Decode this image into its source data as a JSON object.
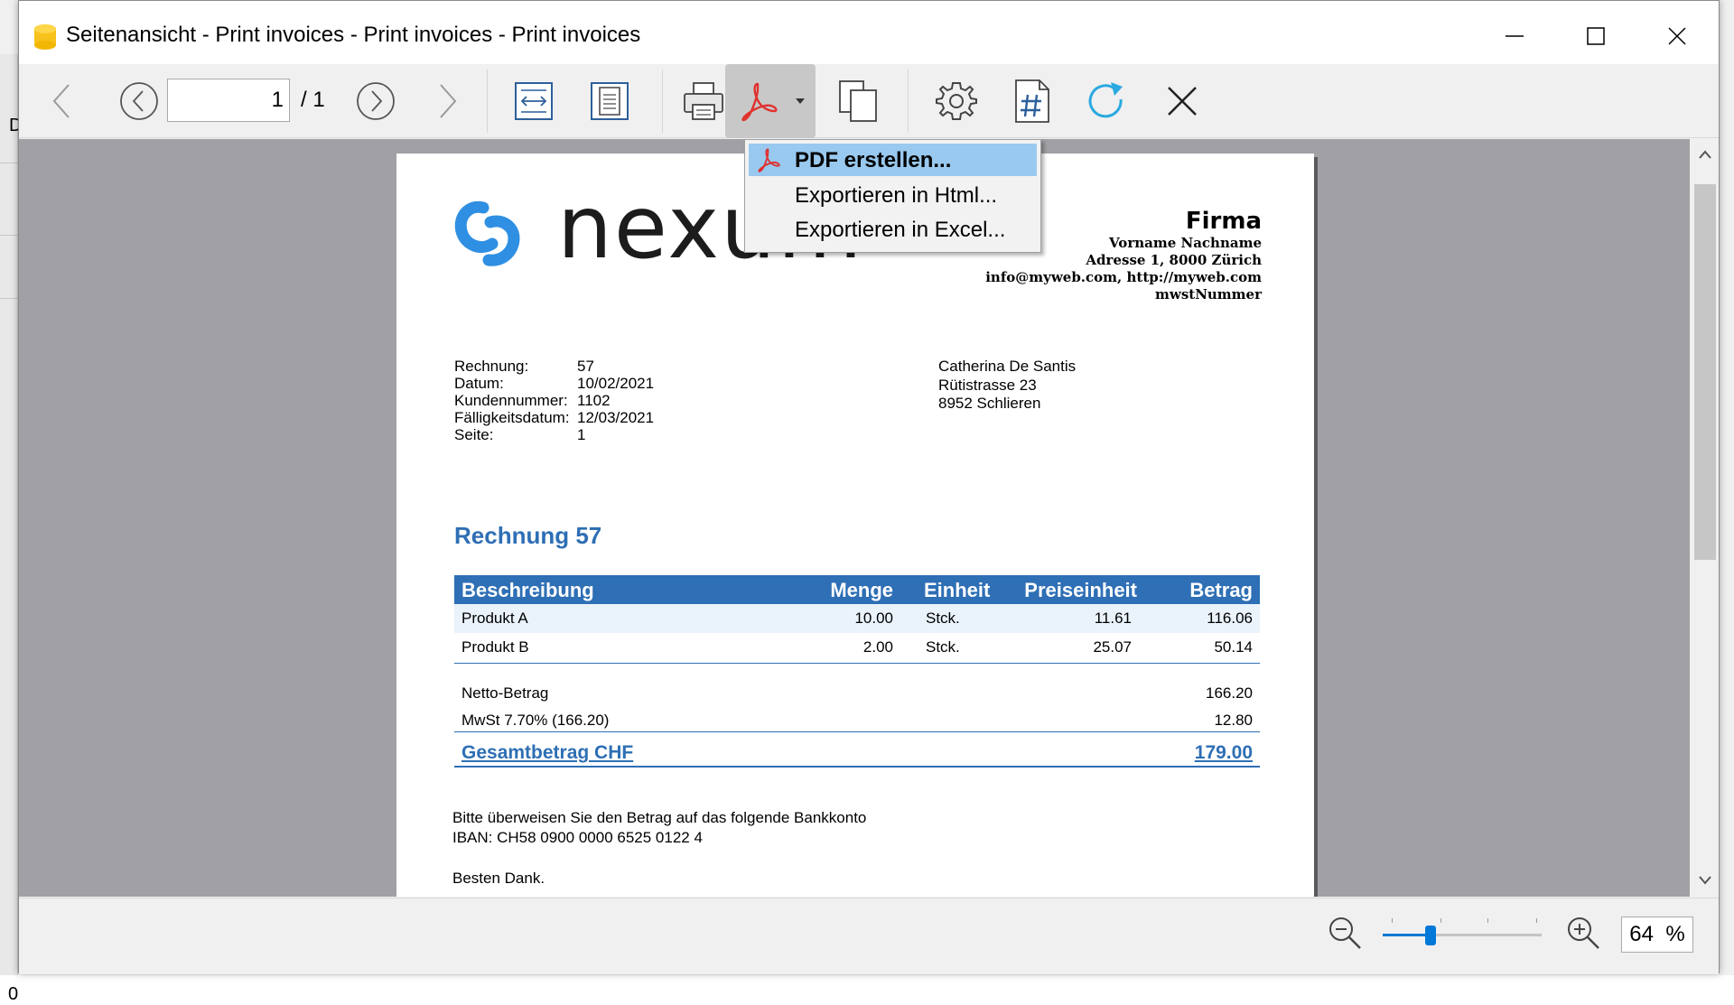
{
  "background": {
    "left_char_top": "D",
    "left_char_bottom": "0"
  },
  "window": {
    "title": "Seitenansicht - Print invoices - Print invoices - Print invoices",
    "icons": [
      "app-icon",
      "minimize-icon",
      "maximize-icon",
      "close-icon"
    ]
  },
  "toolbar": {
    "page_value": "1",
    "page_total": "/ 1",
    "icons": [
      "first-page-icon",
      "previous-page-icon",
      "next-page-icon",
      "last-page-icon",
      "fit-width-icon",
      "fit-page-icon",
      "print-icon",
      "pdf-icon",
      "copy-icon",
      "settings-icon",
      "page-number-icon",
      "refresh-icon",
      "close-preview-icon"
    ]
  },
  "menu": {
    "items": [
      {
        "label": "PDF erstellen...",
        "selected": true
      },
      {
        "label": "Exportieren in Html...",
        "selected": false
      },
      {
        "label": "Exportieren in Excel...",
        "selected": false
      }
    ]
  },
  "invoice": {
    "logo_text": "nexum",
    "company": {
      "name": "Firma",
      "lines": [
        "Vorname Nachname",
        "Adresse 1, 8000 Zürich",
        "info@myweb.com, http://myweb.com",
        "mwstNummer"
      ]
    },
    "meta": [
      {
        "key": "Rechnung:",
        "value": "57"
      },
      {
        "key": "Datum:",
        "value": "10/02/2021"
      },
      {
        "key": "Kundennummer:",
        "value": "1102"
      },
      {
        "key": "Fälligkeitsdatum:",
        "value": "12/03/2021"
      },
      {
        "key": "Seite:",
        "value": "1"
      }
    ],
    "recipient": [
      "Catherina De Santis",
      "Rütistrasse 23",
      "8952 Schlieren"
    ],
    "title": "Rechnung 57",
    "table": {
      "headers": {
        "desc": "Beschreibung",
        "menge": "Menge",
        "einheit": "Einheit",
        "preis": "Preiseinheit",
        "betrag": "Betrag"
      },
      "rows": [
        {
          "desc": "Produkt A",
          "menge": "10.00",
          "einheit": "Stck.",
          "preis": "11.61",
          "betrag": "116.06"
        },
        {
          "desc": "Produkt B",
          "menge": "2.00",
          "einheit": "Stck.",
          "preis": "25.07",
          "betrag": "50.14"
        }
      ]
    },
    "netto": {
      "label": "Netto-Betrag",
      "value": "166.20"
    },
    "mwst": {
      "label": "MwSt 7.70% (166.20)",
      "value": "12.80"
    },
    "total": {
      "label": "Gesamtbetrag CHF",
      "value": "179.00"
    },
    "footer": {
      "line1": "Bitte überweisen Sie den Betrag auf das folgende Bankkonto",
      "line2": "IBAN: CH58 0900 0000 6525 0122 4",
      "line3": "Besten Dank."
    }
  },
  "status": {
    "zoom_value": "64",
    "zoom_unit": "%",
    "zoom_level": 0.3
  },
  "colors": {
    "accent": "#2e6fb5",
    "selection": "#99c9ef",
    "pdf_red": "#e0312f",
    "slider": "#0078d7",
    "refresh": "#29a9e0"
  }
}
